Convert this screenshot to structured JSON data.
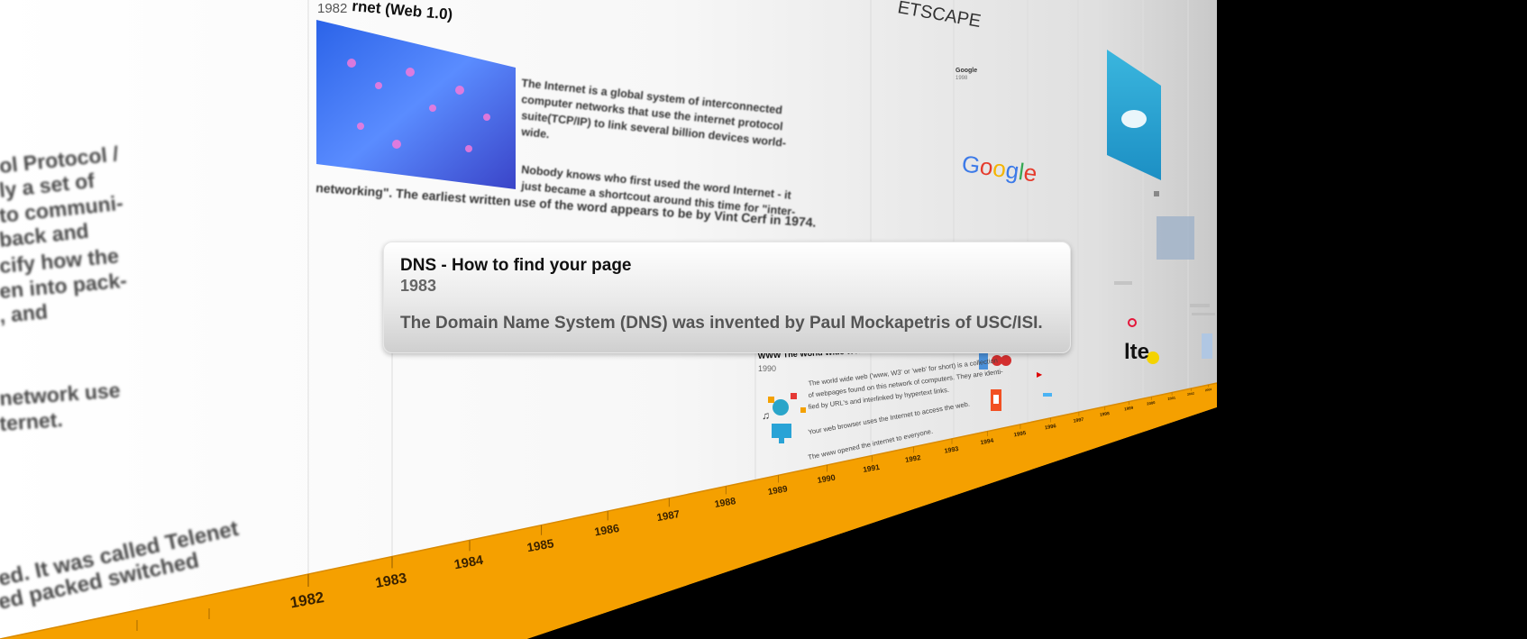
{
  "left_panel_text": {
    "lines": [
      "ol Protocol /",
      "ly a set of",
      "to communi-",
      "back and",
      "cify how the",
      "en into pack-",
      ", and",
      "network use",
      "ternet."
    ],
    "bottom_lines": [
      "ed. It was called Telenet",
      "ed packed switched"
    ]
  },
  "internet_card": {
    "title": "rnet (Web 1.0)",
    "year": "1982",
    "paragraph_lines": [
      "The Internet is a global system of interconnected",
      "computer networks that use the internet protocol",
      "suite(TCP/IP) to link several billion devices world-",
      "wide."
    ],
    "paragraph2_lines": [
      "Nobody knows who first used the word Internet - it",
      "just became a shortcout around this time for \"inter-",
      "networking\". The earliest written use of the word appears to be by Vint Cerf in 1974."
    ]
  },
  "netscape_logo": "ETSCAPE",
  "google_card": {
    "title": "Google",
    "year": "1998",
    "logo": "Google"
  },
  "www_card": {
    "title": "WWW The World Wide Web",
    "year": "1990",
    "lines": [
      "The world wide web ('www, W3' or 'web' for short) is a collection",
      "of webpages found on this network of computers. They are identi-",
      "fied by URL's and interlinked by hypertext links.",
      "Your web browser uses the Internet to access the web.",
      "The www opened the internet to everyone."
    ]
  },
  "lte_logo": "lte",
  "tooltip": {
    "title": "DNS - How to find your page",
    "year": "1983",
    "body": "The Domain Name System (DNS) was invented by Paul Mockapetris of USC/ISI."
  },
  "timeline": {
    "years": [
      "1982",
      "1983",
      "1984",
      "1985",
      "1986",
      "1987",
      "1988",
      "1989",
      "1990",
      "1991",
      "1992",
      "1993",
      "1994",
      "1995",
      "1996",
      "1997",
      "1998",
      "1999",
      "2000",
      "2001",
      "2002",
      "2003",
      "2004",
      "2005",
      "2006",
      "2007",
      "2008",
      "2009",
      "2010",
      "2011",
      "2012",
      "2013",
      "2014",
      "2015",
      "2016",
      "2017",
      "2018",
      "2019",
      "2020",
      "2021",
      "2022",
      "2023",
      "2024",
      "2025",
      "2026",
      "2027",
      "2028",
      "2029",
      "2030"
    ],
    "bar_color": "#f5a000"
  }
}
